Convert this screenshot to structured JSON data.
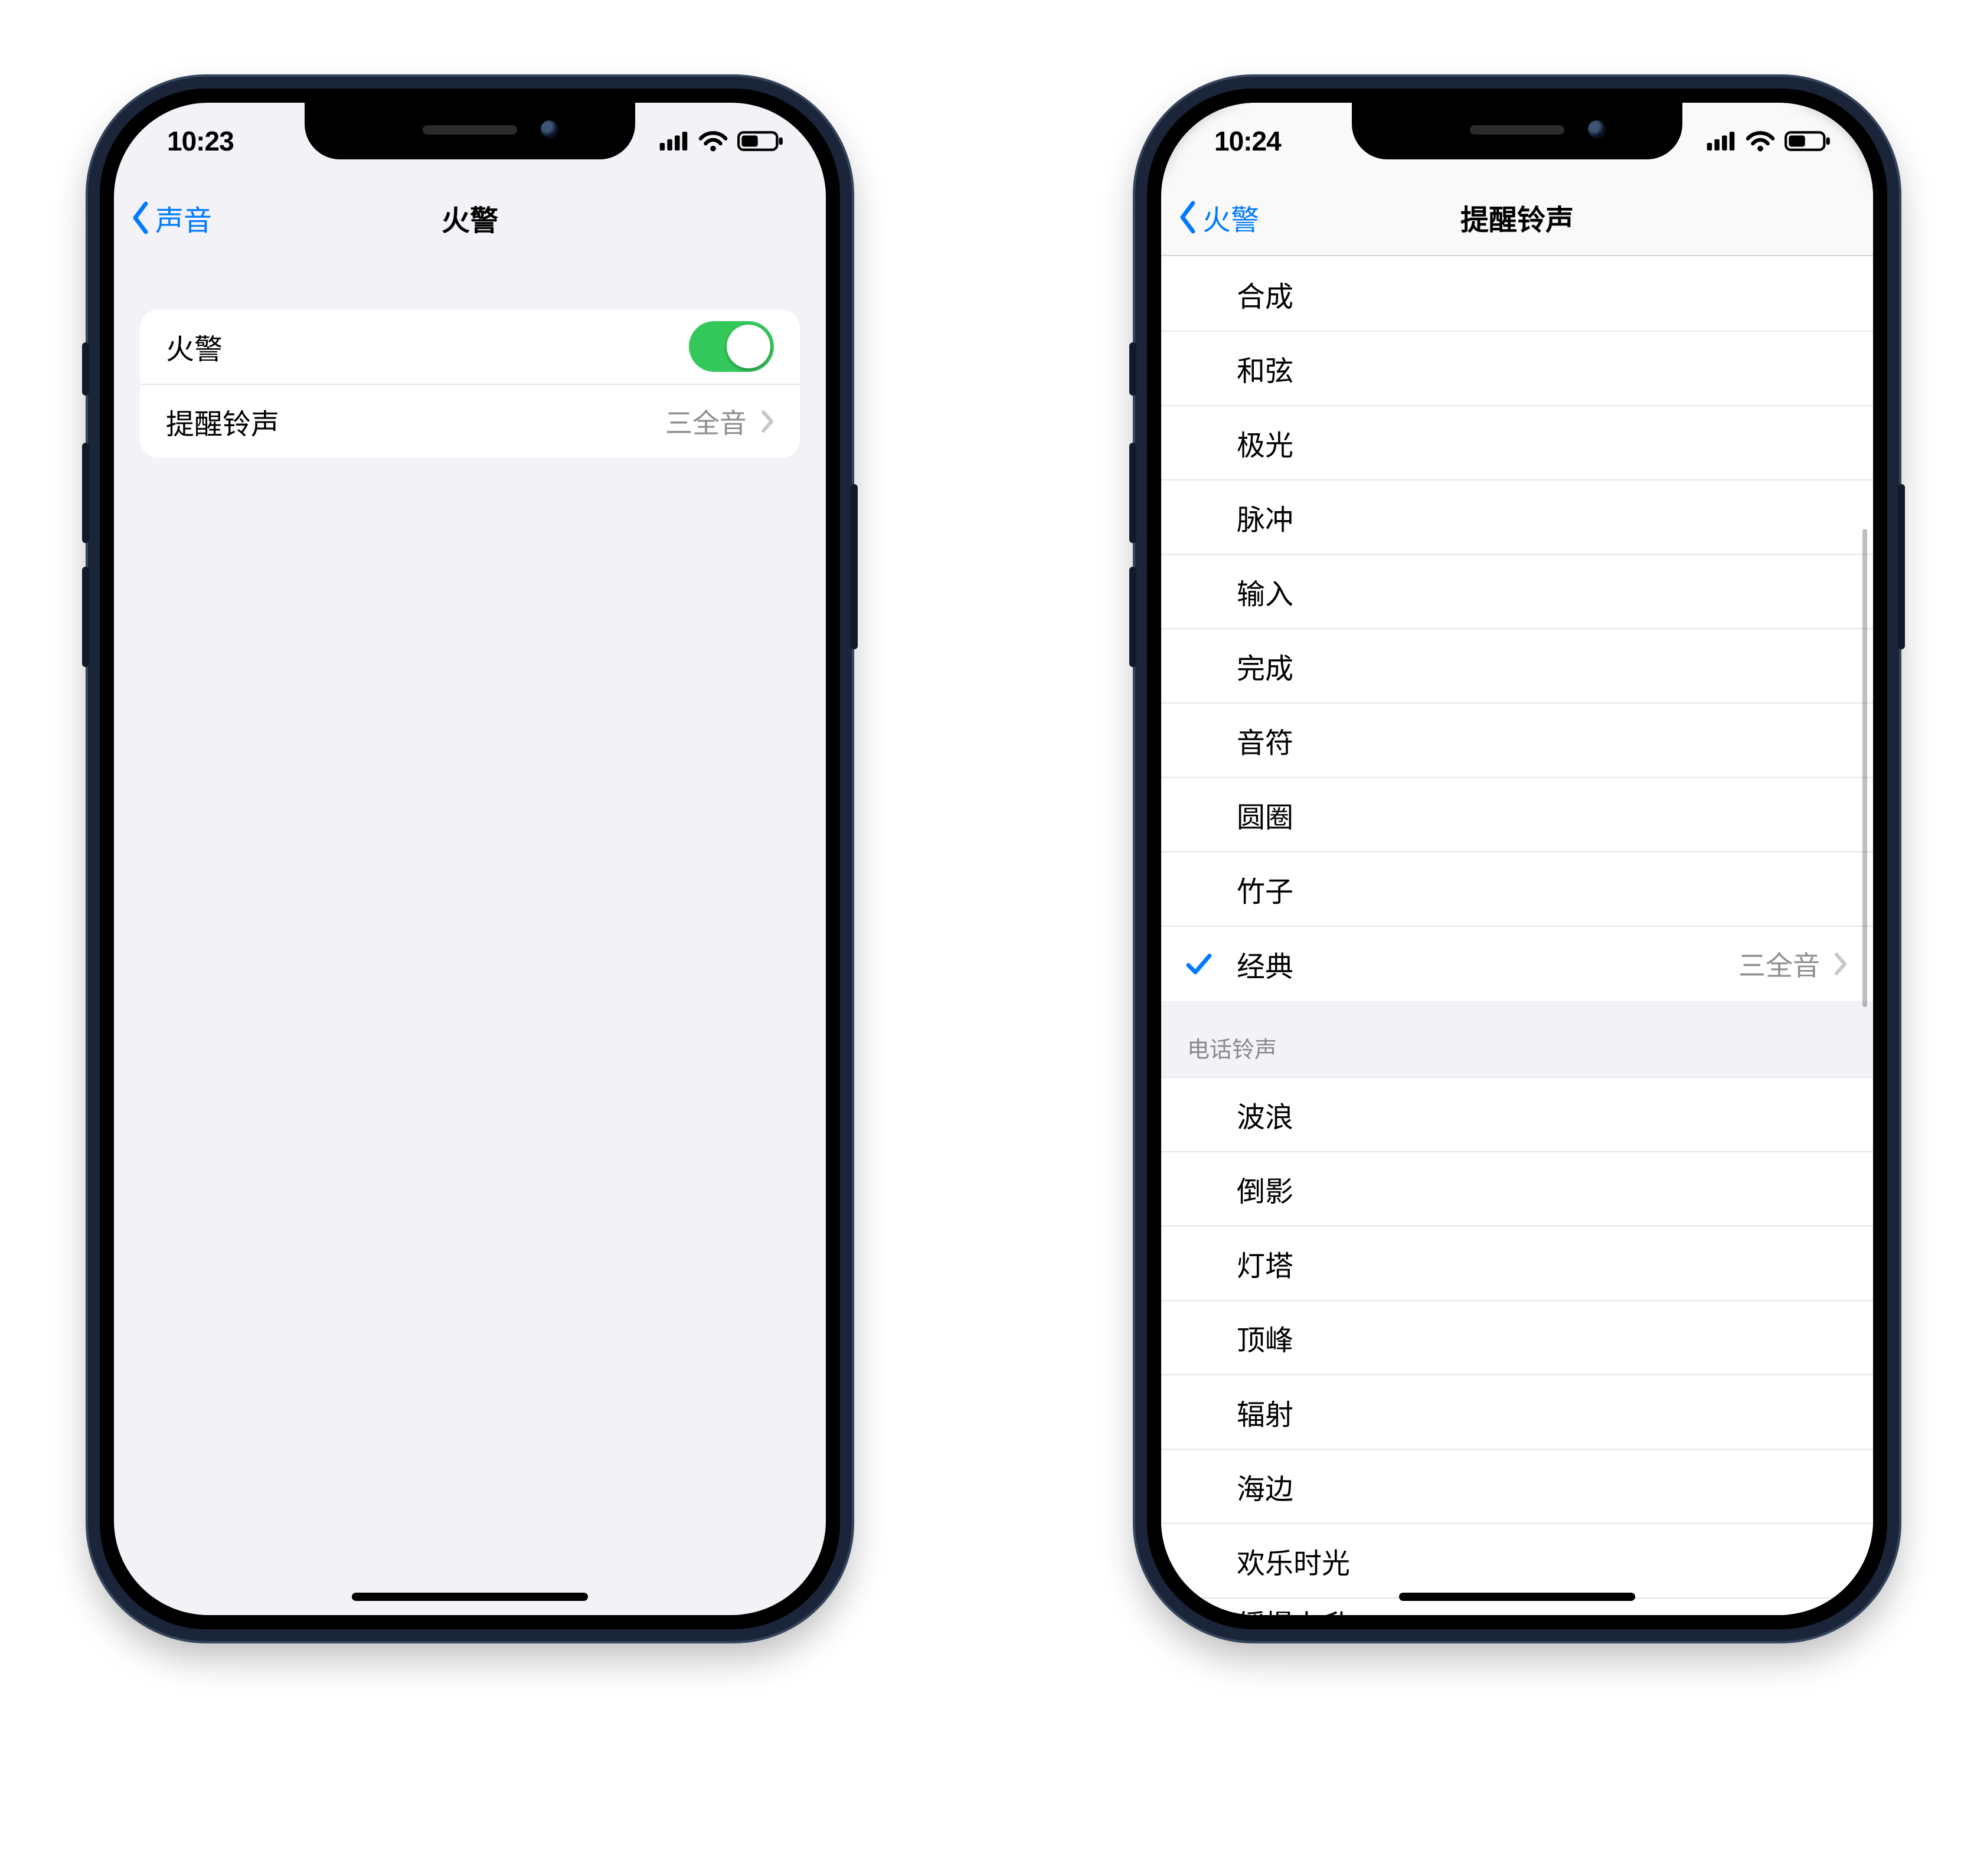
{
  "left": {
    "status_time": "10:23",
    "nav_back": "声音",
    "nav_title": "火警",
    "rows": {
      "fire_alarm_label": "火警",
      "fire_alarm_on": true,
      "alert_label": "提醒铃声",
      "alert_value": "三全音"
    }
  },
  "right": {
    "status_time": "10:24",
    "nav_back": "火警",
    "nav_title": "提醒铃声",
    "section1": [
      {
        "label": "合成"
      },
      {
        "label": "和弦"
      },
      {
        "label": "极光"
      },
      {
        "label": "脉冲"
      },
      {
        "label": "输入"
      },
      {
        "label": "完成"
      },
      {
        "label": "音符"
      },
      {
        "label": "圆圈"
      },
      {
        "label": "竹子"
      },
      {
        "label": "经典",
        "checked": true,
        "value": "三全音",
        "disclosure": true
      }
    ],
    "section2_header": "电话铃声",
    "section2": [
      {
        "label": "波浪"
      },
      {
        "label": "倒影"
      },
      {
        "label": "灯塔"
      },
      {
        "label": "顶峰"
      },
      {
        "label": "辐射"
      },
      {
        "label": "海边"
      },
      {
        "label": "欢乐时光"
      },
      {
        "label": "缓慢上升"
      }
    ]
  }
}
